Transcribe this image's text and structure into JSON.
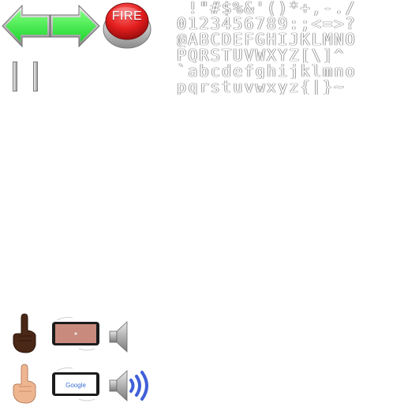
{
  "controls": {
    "fire_label": "FIRE",
    "left_arrow_icon": "arrow-left-green",
    "right_arrow_icon": "arrow-right-green",
    "pause_icon": "pause-bars"
  },
  "font_atlas": {
    "rows": [
      " !\"#$%&'()*+,-./",
      "0123456789:;<=>?",
      "@ABCDEFGHIJKLMNO",
      "PQRSTUVWXYZ[\\]^_",
      "`abcdefghijklmno",
      "pqrstuvwxyz{|}~"
    ]
  },
  "tutorial": {
    "phone_brand": "Google",
    "icons": [
      "finger-tap-dark",
      "phone-tilt",
      "speaker-muted",
      "finger-tap-light",
      "phone-browser",
      "speaker-sound-waves"
    ]
  },
  "colors": {
    "arrow_green": "#3bea45",
    "fire_red": "#e21d1d",
    "sound_wave_blue": "#3f5fd8"
  }
}
